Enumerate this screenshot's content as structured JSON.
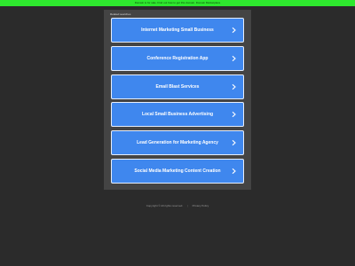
{
  "banner": {
    "text": "Domain is for sale. Find out how to get this domain. Domain Marketplace"
  },
  "panel": {
    "title": "Related searches"
  },
  "links": [
    {
      "label": "Internet Marketing Small Business"
    },
    {
      "label": "Conference Registration App"
    },
    {
      "label": "Email Blast Services"
    },
    {
      "label": "Local Small Business Advertising"
    },
    {
      "label": "Lead Generation for Marketing Agency"
    },
    {
      "label": "Social Media Marketing Content Creation"
    }
  ],
  "footer": {
    "copyright": "Copyright © All rights reserved.",
    "privacy_label": "Privacy Policy"
  },
  "colors": {
    "banner": "#2ee82e",
    "page_background": "#2b2b2b",
    "panel_background": "#444444",
    "link_background": "#3f87ee"
  }
}
